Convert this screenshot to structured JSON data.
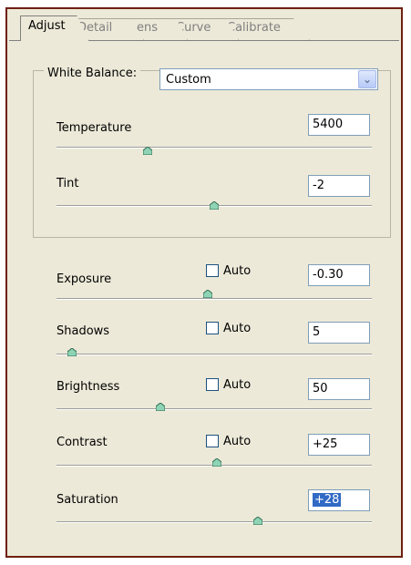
{
  "tabs": [
    {
      "label": "Adjust",
      "active": true
    },
    {
      "label": "Detail",
      "active": false
    },
    {
      "label": "Lens",
      "active": false
    },
    {
      "label": "Curve",
      "active": false
    },
    {
      "label": "Calibrate",
      "active": false
    }
  ],
  "white_balance": {
    "label": "White Balance:",
    "value": "Custom"
  },
  "controls": {
    "temperature": {
      "label": "Temperature",
      "value": "5400",
      "slider": 0.29
    },
    "tint": {
      "label": "Tint",
      "value": "-2",
      "slider": 0.5
    },
    "exposure": {
      "label": "Exposure",
      "auto_label": "Auto",
      "value": "-0.30",
      "slider": 0.48
    },
    "shadows": {
      "label": "Shadows",
      "auto_label": "Auto",
      "value": "5",
      "slider": 0.05
    },
    "brightness": {
      "label": "Brightness",
      "auto_label": "Auto",
      "value": "50",
      "slider": 0.33
    },
    "contrast": {
      "label": "Contrast",
      "auto_label": "Auto",
      "value": "+25",
      "slider": 0.51
    },
    "saturation": {
      "label": "Saturation",
      "value": "+28",
      "slider": 0.64
    }
  },
  "colors": {
    "frame_border": "#6e1f12",
    "panel_bg": "#ece9d8",
    "selection": "#316ac5"
  }
}
